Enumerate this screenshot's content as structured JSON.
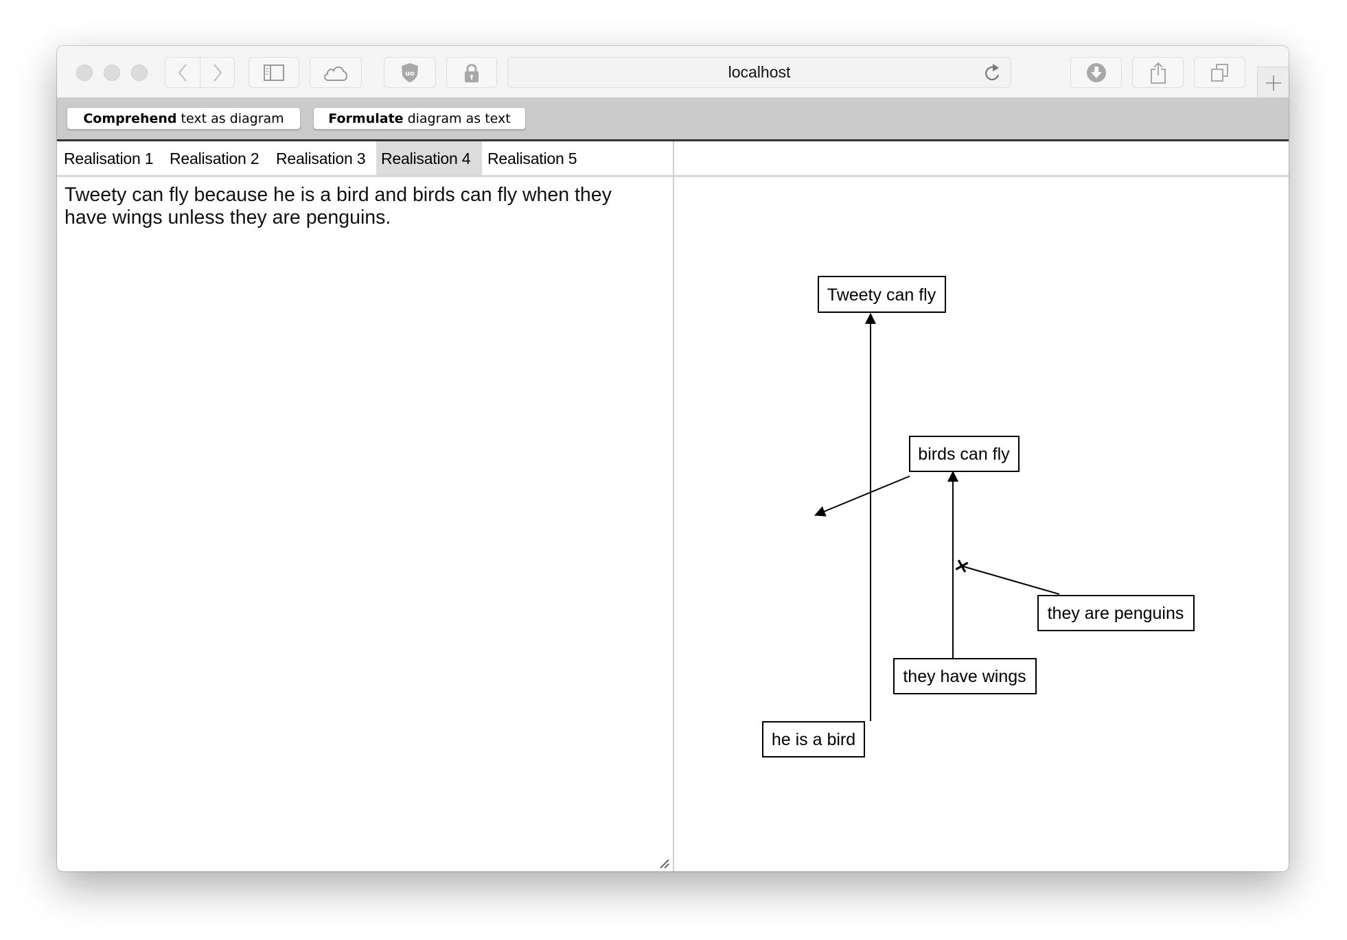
{
  "browser": {
    "address": "localhost",
    "buttons": [
      "back",
      "forward",
      "sidebar",
      "icloud-tabs",
      "ublock",
      "privacy-lock",
      "downloads",
      "share",
      "show-tabs",
      "new-tab"
    ]
  },
  "actions": {
    "comprehend": {
      "bold": "Comprehend",
      "rest": "text as diagram"
    },
    "formulate": {
      "bold": "Formulate",
      "rest": "diagram as text"
    }
  },
  "tabs": [
    {
      "label": "Realisation 1",
      "active": false
    },
    {
      "label": "Realisation 2",
      "active": false
    },
    {
      "label": "Realisation 3",
      "active": false
    },
    {
      "label": "Realisation 4",
      "active": true
    },
    {
      "label": "Realisation 5",
      "active": false
    }
  ],
  "text": "Tweety can fly because he is a bird and birds can fly when they have wings unless they are penguins.",
  "diagram": {
    "nodes": [
      {
        "id": "tweety",
        "label": "Tweety can fly"
      },
      {
        "id": "birds",
        "label": "birds can fly"
      },
      {
        "id": "penguins",
        "label": "they are penguins"
      },
      {
        "id": "wings",
        "label": "they have wings"
      },
      {
        "id": "bird",
        "label": "he is a bird"
      }
    ],
    "edges": [
      {
        "from": "bird",
        "to": "tweety",
        "type": "support"
      },
      {
        "from": "birds",
        "to": "edge:bird->tweety",
        "type": "support"
      },
      {
        "from": "wings",
        "to": "birds",
        "type": "support"
      },
      {
        "from": "penguins",
        "to": "edge:wings->birds",
        "type": "attack"
      }
    ]
  }
}
